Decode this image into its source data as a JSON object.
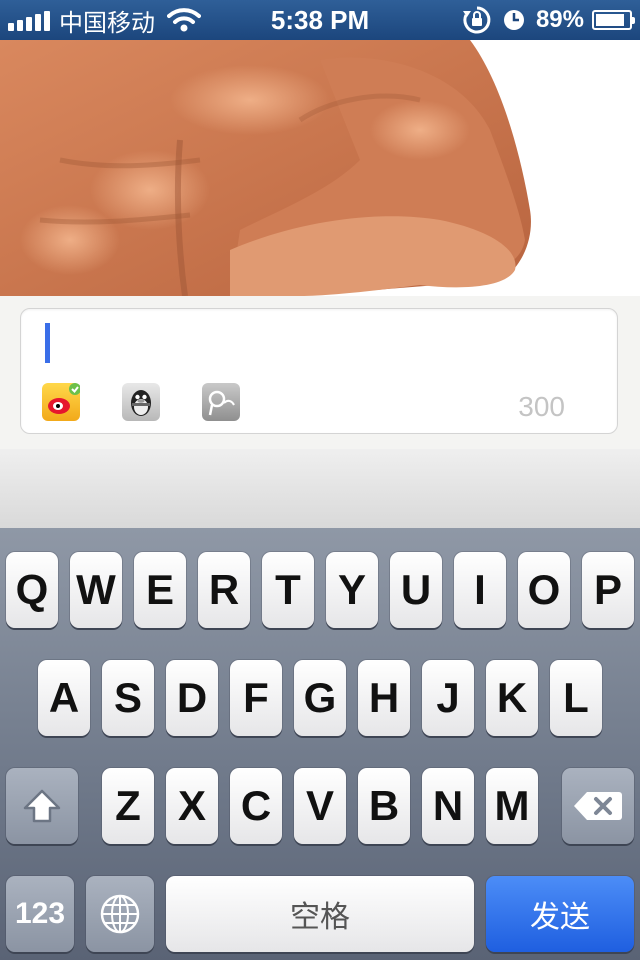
{
  "status_bar": {
    "carrier": "中国移动",
    "time": "5:38 PM",
    "battery_text": "89%",
    "battery_level": 0.89
  },
  "compose": {
    "char_count": "300",
    "share_icons": [
      "weibo-icon",
      "qq-penguin-icon",
      "tencent-weibo-icon"
    ]
  },
  "keyboard": {
    "row1": [
      "Q",
      "W",
      "E",
      "R",
      "T",
      "Y",
      "U",
      "I",
      "O",
      "P"
    ],
    "row2": [
      "A",
      "S",
      "D",
      "F",
      "G",
      "H",
      "J",
      "K",
      "L"
    ],
    "row3": [
      "Z",
      "X",
      "C",
      "V",
      "B",
      "N",
      "M"
    ],
    "num_key": "123",
    "space_key": "空格",
    "send_key": "发送"
  },
  "colors": {
    "status_bar": "#1c467d",
    "caret": "#3a6ee8",
    "send_button": "#1f5fe0",
    "keyboard_bg": "#6e7889"
  }
}
